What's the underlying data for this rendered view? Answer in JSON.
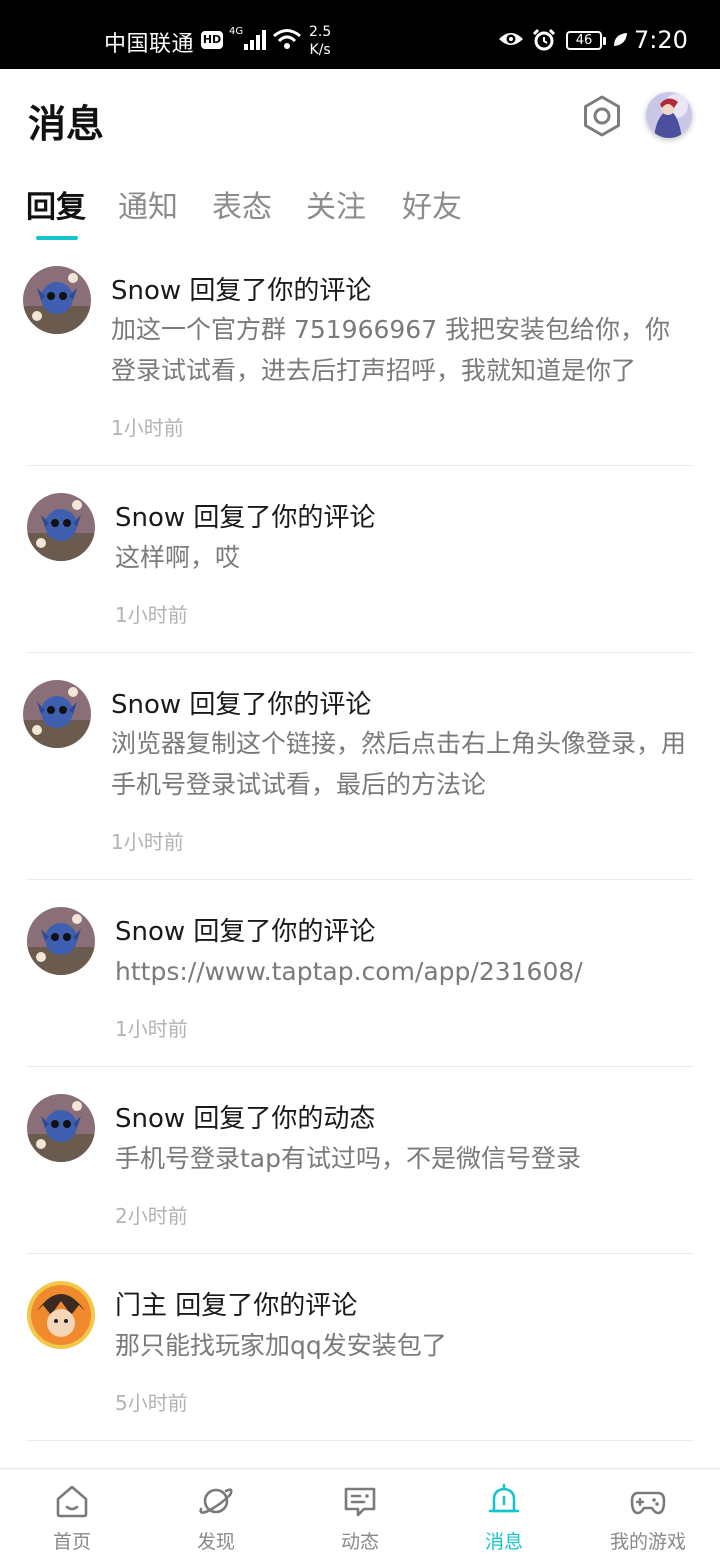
{
  "status_bar": {
    "carrier": "中国联通",
    "hd_badge": "HD",
    "network": "4G",
    "speed_value": "2.5",
    "speed_unit": "K/s",
    "battery": "46",
    "time": "7:20"
  },
  "header": {
    "title": "消息"
  },
  "tabs": [
    {
      "label": "回复",
      "active": true
    },
    {
      "label": "通知",
      "active": false
    },
    {
      "label": "表态",
      "active": false
    },
    {
      "label": "关注",
      "active": false
    },
    {
      "label": "好友",
      "active": false
    }
  ],
  "messages": [
    {
      "author": "Snow 回复了你的评论",
      "content": "加这一个官方群 751966967 我把安装包给你，你登录试试看，进去后打声招呼，我就知道是你了",
      "time": "1小时前"
    },
    {
      "author": "Snow 回复了你的评论",
      "content": "这样啊，哎",
      "time": "1小时前"
    },
    {
      "author": "Snow 回复了你的评论",
      "content": "浏览器复制这个链接，然后点击右上角头像登录，用手机号登录试试看，最后的方法论",
      "time": "1小时前"
    },
    {
      "author": "Snow 回复了你的评论",
      "content": "https://www.taptap.com/app/231608/",
      "time": "1小时前"
    },
    {
      "author": "Snow 回复了你的动态",
      "content": "手机号登录tap有试过吗，不是微信号登录",
      "time": "2小时前"
    },
    {
      "author": "门主 回复了你的评论",
      "content": "那只能找玩家加qq发安装包了",
      "time": "5小时前"
    }
  ],
  "bottom_nav": [
    {
      "label": "首页",
      "icon": "home-icon",
      "active": false
    },
    {
      "label": "发现",
      "icon": "planet-icon",
      "active": false
    },
    {
      "label": "动态",
      "icon": "chat-icon",
      "active": false
    },
    {
      "label": "消息",
      "icon": "bell-icon",
      "active": true
    },
    {
      "label": "我的游戏",
      "icon": "gamepad-icon",
      "active": false
    }
  ],
  "colors": {
    "accent": "#15c5ce",
    "text_primary": "#1a1a1a",
    "text_secondary": "#7a7a7a",
    "text_time": "#b3b3b3"
  }
}
